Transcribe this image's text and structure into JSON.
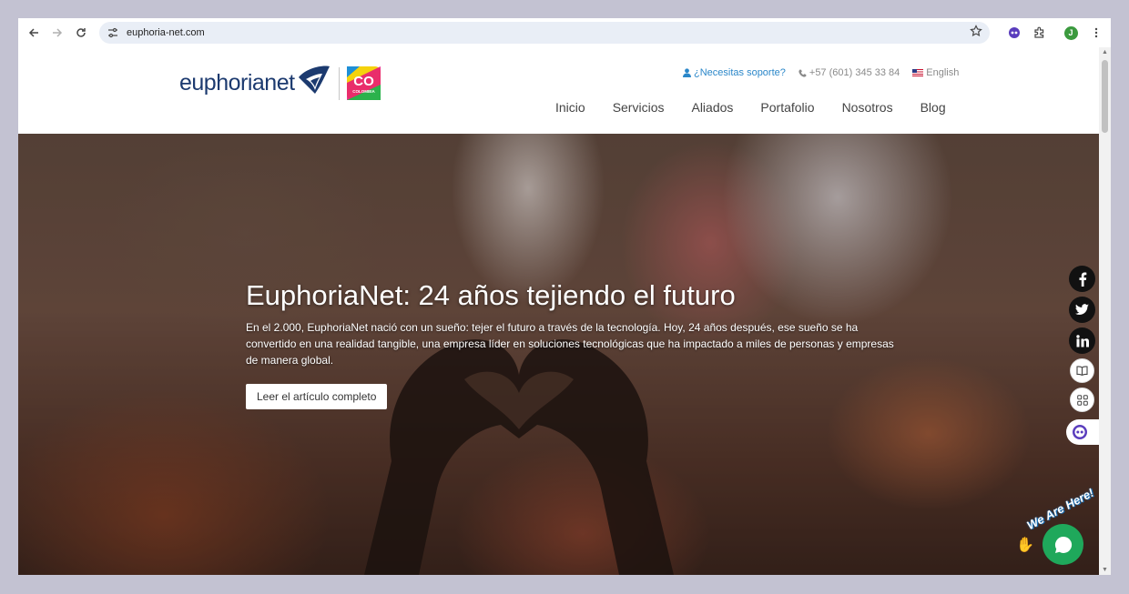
{
  "browser": {
    "url": "euphoria-net.com",
    "profile_initial": "J"
  },
  "header": {
    "logo_text": "euphorianet",
    "badge_text": "CO",
    "badge_sub": "COLOMBIA",
    "support_label": "¿Necesitas soporte?",
    "phone": "+57 (601) 345 33 84",
    "language": "English"
  },
  "nav": {
    "items": [
      "Inicio",
      "Servicios",
      "Aliados",
      "Portafolio",
      "Nosotros",
      "Blog"
    ]
  },
  "hero": {
    "title": "EuphoriaNet: 24 años tejiendo el futuro",
    "text": "En el 2.000, EuphoriaNet nació con un sueño: tejer el futuro a través de la tecnología. Hoy, 24 años después, ese sueño se ha convertido en una realidad tangible, una empresa líder en soluciones tecnológicas que ha impactado a miles de personas y empresas de manera global.",
    "button": "Leer el artículo completo"
  },
  "chat": {
    "banner": "We Are Here!"
  },
  "colors": {
    "brand_navy": "#1c3a6f",
    "support_link": "#2b87c9",
    "chat_green": "#1fa85b"
  }
}
